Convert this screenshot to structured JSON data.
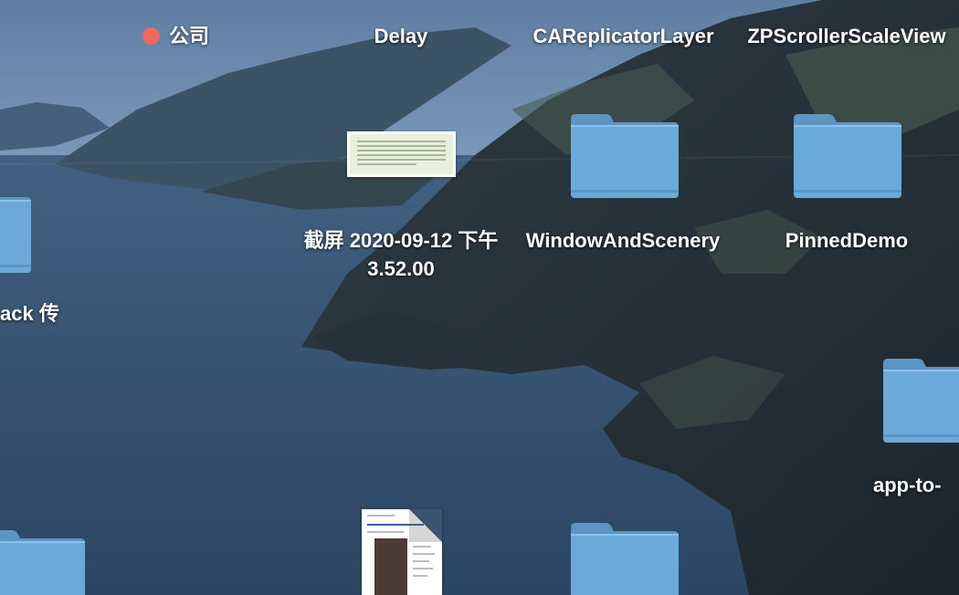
{
  "desktop": {
    "items": [
      {
        "label": "公司",
        "kind": "text-tag",
        "tag_color": "#ee6a5f"
      },
      {
        "label": "Delay",
        "kind": "text"
      },
      {
        "label": "CAReplicatorLayer",
        "kind": "text"
      },
      {
        "label": "ZPScrollerScaleView",
        "kind": "text"
      },
      {
        "label": "截屏 2020-09-12 下午 3.52.00",
        "kind": "screenshot-file"
      },
      {
        "label": "WindowAndScenery",
        "kind": "folder"
      },
      {
        "label": "PinnedDemo",
        "kind": "folder"
      },
      {
        "label": "ack  传",
        "kind": "folder"
      },
      {
        "label": "app-to-",
        "kind": "folder"
      },
      {
        "label": "",
        "kind": "folder"
      },
      {
        "label": "",
        "kind": "document"
      },
      {
        "label": "",
        "kind": "folder"
      }
    ]
  },
  "colors": {
    "folder_body": "#6aa9d8",
    "folder_tab": "#5c94c2",
    "tag_red": "#ee6a5f"
  }
}
